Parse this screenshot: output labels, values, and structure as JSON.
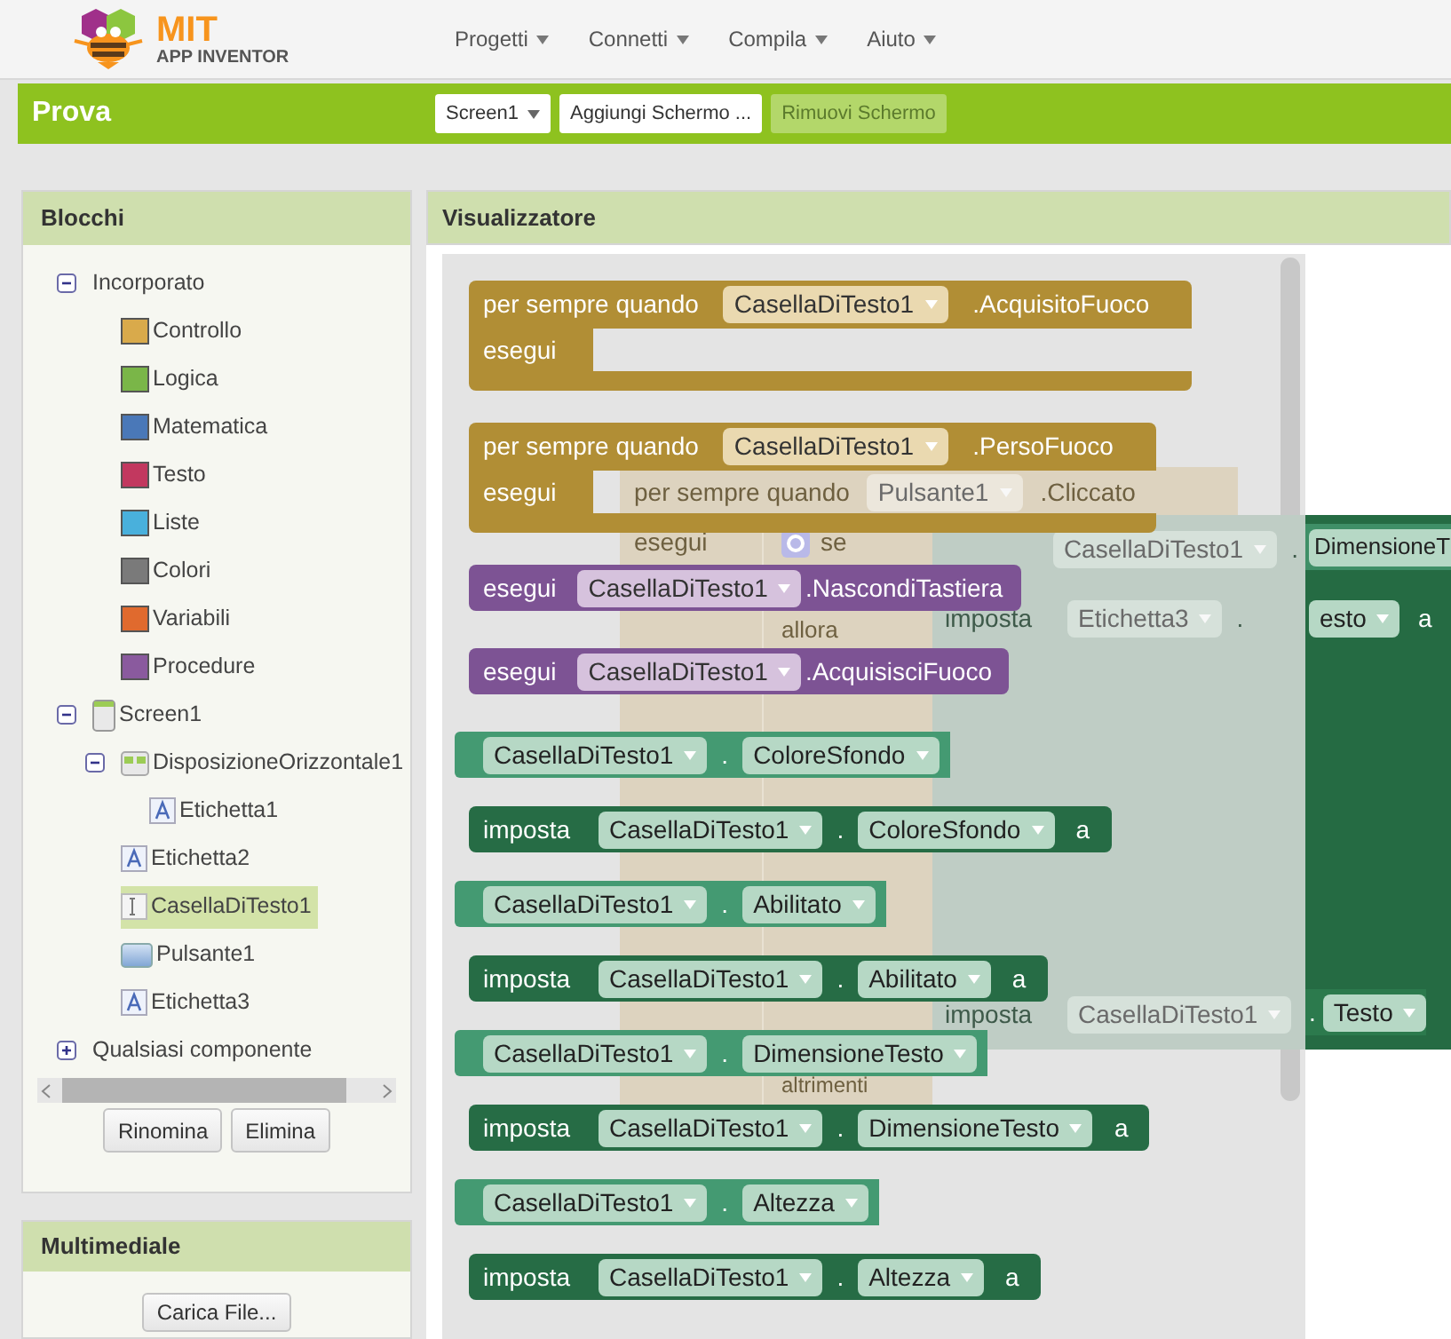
{
  "header": {
    "logo": {
      "title": "MIT",
      "subtitle": "APP INVENTOR"
    },
    "menus": [
      {
        "label": "Progetti"
      },
      {
        "label": "Connetti"
      },
      {
        "label": "Compila"
      },
      {
        "label": "Aiuto"
      }
    ]
  },
  "project_bar": {
    "title": "Prova",
    "screen_select": "Screen1",
    "buttons": [
      {
        "label": "Aggiungi Schermo ...",
        "disabled": false
      },
      {
        "label": "Rimuovi Schermo",
        "disabled": true
      }
    ]
  },
  "blocks_panel": {
    "title": "Blocchi",
    "tree": [
      {
        "kind": "folder",
        "label": "Incorporato",
        "expanded": true,
        "selected": false,
        "children": [
          {
            "kind": "category",
            "label": "Controllo",
            "color": "#d9aa4b",
            "selected": false
          },
          {
            "kind": "category",
            "label": "Logica",
            "color": "#7ab648",
            "selected": false
          },
          {
            "kind": "category",
            "label": "Matematica",
            "color": "#4a78b8",
            "selected": false
          },
          {
            "kind": "category",
            "label": "Testo",
            "color": "#c2385f",
            "selected": false
          },
          {
            "kind": "category",
            "label": "Liste",
            "color": "#49b0dc",
            "selected": false
          },
          {
            "kind": "category",
            "label": "Colori",
            "color": "#7a7a7a",
            "selected": false
          },
          {
            "kind": "category",
            "label": "Variabili",
            "color": "#e06a2e",
            "selected": false
          },
          {
            "kind": "category",
            "label": "Procedure",
            "color": "#8a5a9e",
            "selected": false
          }
        ]
      },
      {
        "kind": "screen",
        "label": "Screen1",
        "expanded": true,
        "selected": false,
        "children": [
          {
            "kind": "arrangement",
            "label": "DisposizioneOrizzontale1",
            "expanded": true,
            "selected": false,
            "children": [
              {
                "kind": "label",
                "label": "Etichetta1",
                "selected": false
              }
            ]
          },
          {
            "kind": "label",
            "label": "Etichetta2",
            "selected": false
          },
          {
            "kind": "textbox",
            "label": "CasellaDiTesto1",
            "selected": true
          },
          {
            "kind": "button",
            "label": "Pulsante1",
            "selected": false
          },
          {
            "kind": "label",
            "label": "Etichetta3",
            "selected": false
          }
        ]
      },
      {
        "kind": "folder",
        "label": "Qualsiasi componente",
        "expanded": false,
        "selected": false
      }
    ],
    "buttons": [
      "Rinomina",
      "Elimina"
    ]
  },
  "media_panel": {
    "title": "Multimediale",
    "button": "Carica File..."
  },
  "viewer": {
    "title": "Visualizzatore",
    "workspace": {
      "event": {
        "label": "per sempre quando",
        "component": "Pulsante1",
        "member": ".Cliccato",
        "body_label": "esegui"
      },
      "if_block": {
        "label": "se",
        "then_label": "allora",
        "else_label": "altrimenti"
      },
      "set_block": {
        "rows": [
          {
            "kind": "getter",
            "component": "CasellaDiTesto1",
            "separator": ".",
            "property": "DimensioneT"
          },
          {
            "kind": "setter",
            "label": "imposta",
            "component": "Etichetta3",
            "separator": ".",
            "property": "esto",
            "to": "a"
          },
          {
            "kind": "setter",
            "label": "imposta",
            "component": "CasellaDiTesto1",
            "separator": ".",
            "property": "Testo"
          }
        ]
      }
    },
    "flyout": [
      {
        "kind": "event",
        "label": "per sempre quando",
        "component": "CasellaDiTesto1",
        "member": ".AcquisitoFuoco",
        "body_label": "esegui"
      },
      {
        "kind": "event",
        "label": "per sempre quando",
        "component": "CasellaDiTesto1",
        "member": ".PersoFuoco",
        "body_label": "esegui"
      },
      {
        "kind": "call",
        "label": "esegui",
        "component": "CasellaDiTesto1",
        "member": ".NascondiTastiera"
      },
      {
        "kind": "call",
        "label": "esegui",
        "component": "CasellaDiTesto1",
        "member": ".AcquisisciFuoco"
      },
      {
        "kind": "getter",
        "component": "CasellaDiTesto1",
        "separator": ".",
        "property": "ColoreSfondo"
      },
      {
        "kind": "setter",
        "label": "imposta",
        "component": "CasellaDiTesto1",
        "separator": ".",
        "property": "ColoreSfondo",
        "to": "a"
      },
      {
        "kind": "getter",
        "component": "CasellaDiTesto1",
        "separator": ".",
        "property": "Abilitato"
      },
      {
        "kind": "setter",
        "label": "imposta",
        "component": "CasellaDiTesto1",
        "separator": ".",
        "property": "Abilitato",
        "to": "a"
      },
      {
        "kind": "getter",
        "component": "CasellaDiTesto1",
        "separator": ".",
        "property": "DimensioneTesto"
      },
      {
        "kind": "setter",
        "label": "imposta",
        "component": "CasellaDiTesto1",
        "separator": ".",
        "property": "DimensioneTesto",
        "to": "a"
      },
      {
        "kind": "getter",
        "component": "CasellaDiTesto1",
        "separator": ".",
        "property": "Altezza"
      },
      {
        "kind": "setter",
        "label": "imposta",
        "component": "CasellaDiTesto1",
        "separator": ".",
        "property": "Altezza",
        "to": "a"
      }
    ]
  }
}
